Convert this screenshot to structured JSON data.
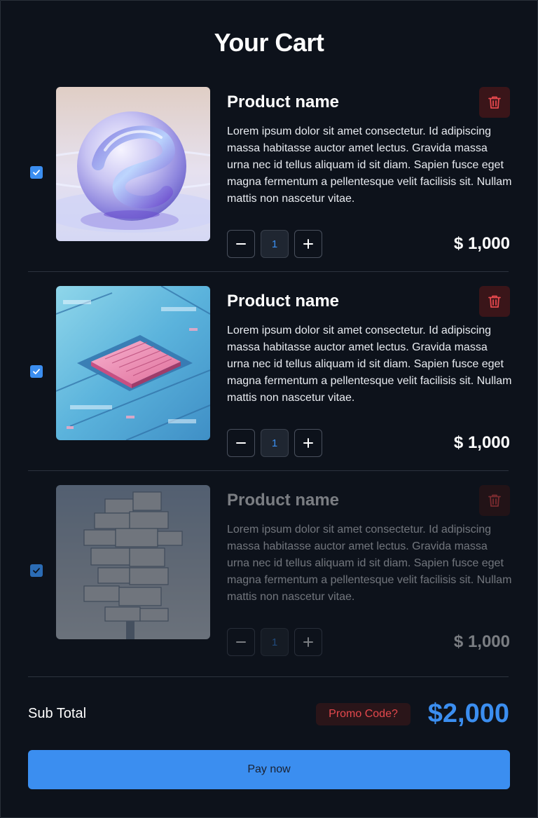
{
  "page": {
    "title": "Your Cart"
  },
  "items": [
    {
      "name": "Product name",
      "description": "Lorem ipsum dolor sit amet consectetur. Id adipiscing massa habitasse auctor amet lectus. Gravida massa urna nec id tellus aliquam id sit diam. Sapien fusce eget magna fermentum a pellentesque velit facilisis sit. Nullam mattis non nascetur vitae.",
      "quantity": "1",
      "price": "$ 1,000",
      "selected": true,
      "image": "glass-sphere-image"
    },
    {
      "name": "Product name",
      "description": "Lorem ipsum dolor sit amet consectetur. Id adipiscing massa habitasse auctor amet lectus. Gravida massa urna nec id tellus aliquam id sit diam. Sapien fusce eget magna fermentum a pellentesque velit facilisis sit. Nullam mattis non nascetur vitae.",
      "quantity": "1",
      "price": "$ 1,000",
      "selected": true,
      "image": "circuit-chip-image"
    },
    {
      "name": "Product name",
      "description": "Lorem ipsum dolor sit amet consectetur. Id adipiscing massa habitasse auctor amet lectus. Gravida massa urna nec id tellus aliquam id sit diam. Sapien fusce eget magna fermentum a pellentesque velit facilisis sit. Nullam mattis non nascetur vitae.",
      "quantity": "1",
      "price": "$ 1,000",
      "selected": true,
      "image": "glass-tower-image"
    }
  ],
  "summary": {
    "subtotal_label": "Sub Total",
    "promo_label": "Promo Code?",
    "total": "$2,000",
    "pay_label": "Pay now"
  },
  "colors": {
    "background": "#0d121b",
    "accent": "#3b8ef0",
    "danger": "#e5484d"
  },
  "icons": {
    "checkbox": "check-icon",
    "delete": "trash-icon",
    "decrease": "minus-icon",
    "increase": "plus-icon"
  }
}
